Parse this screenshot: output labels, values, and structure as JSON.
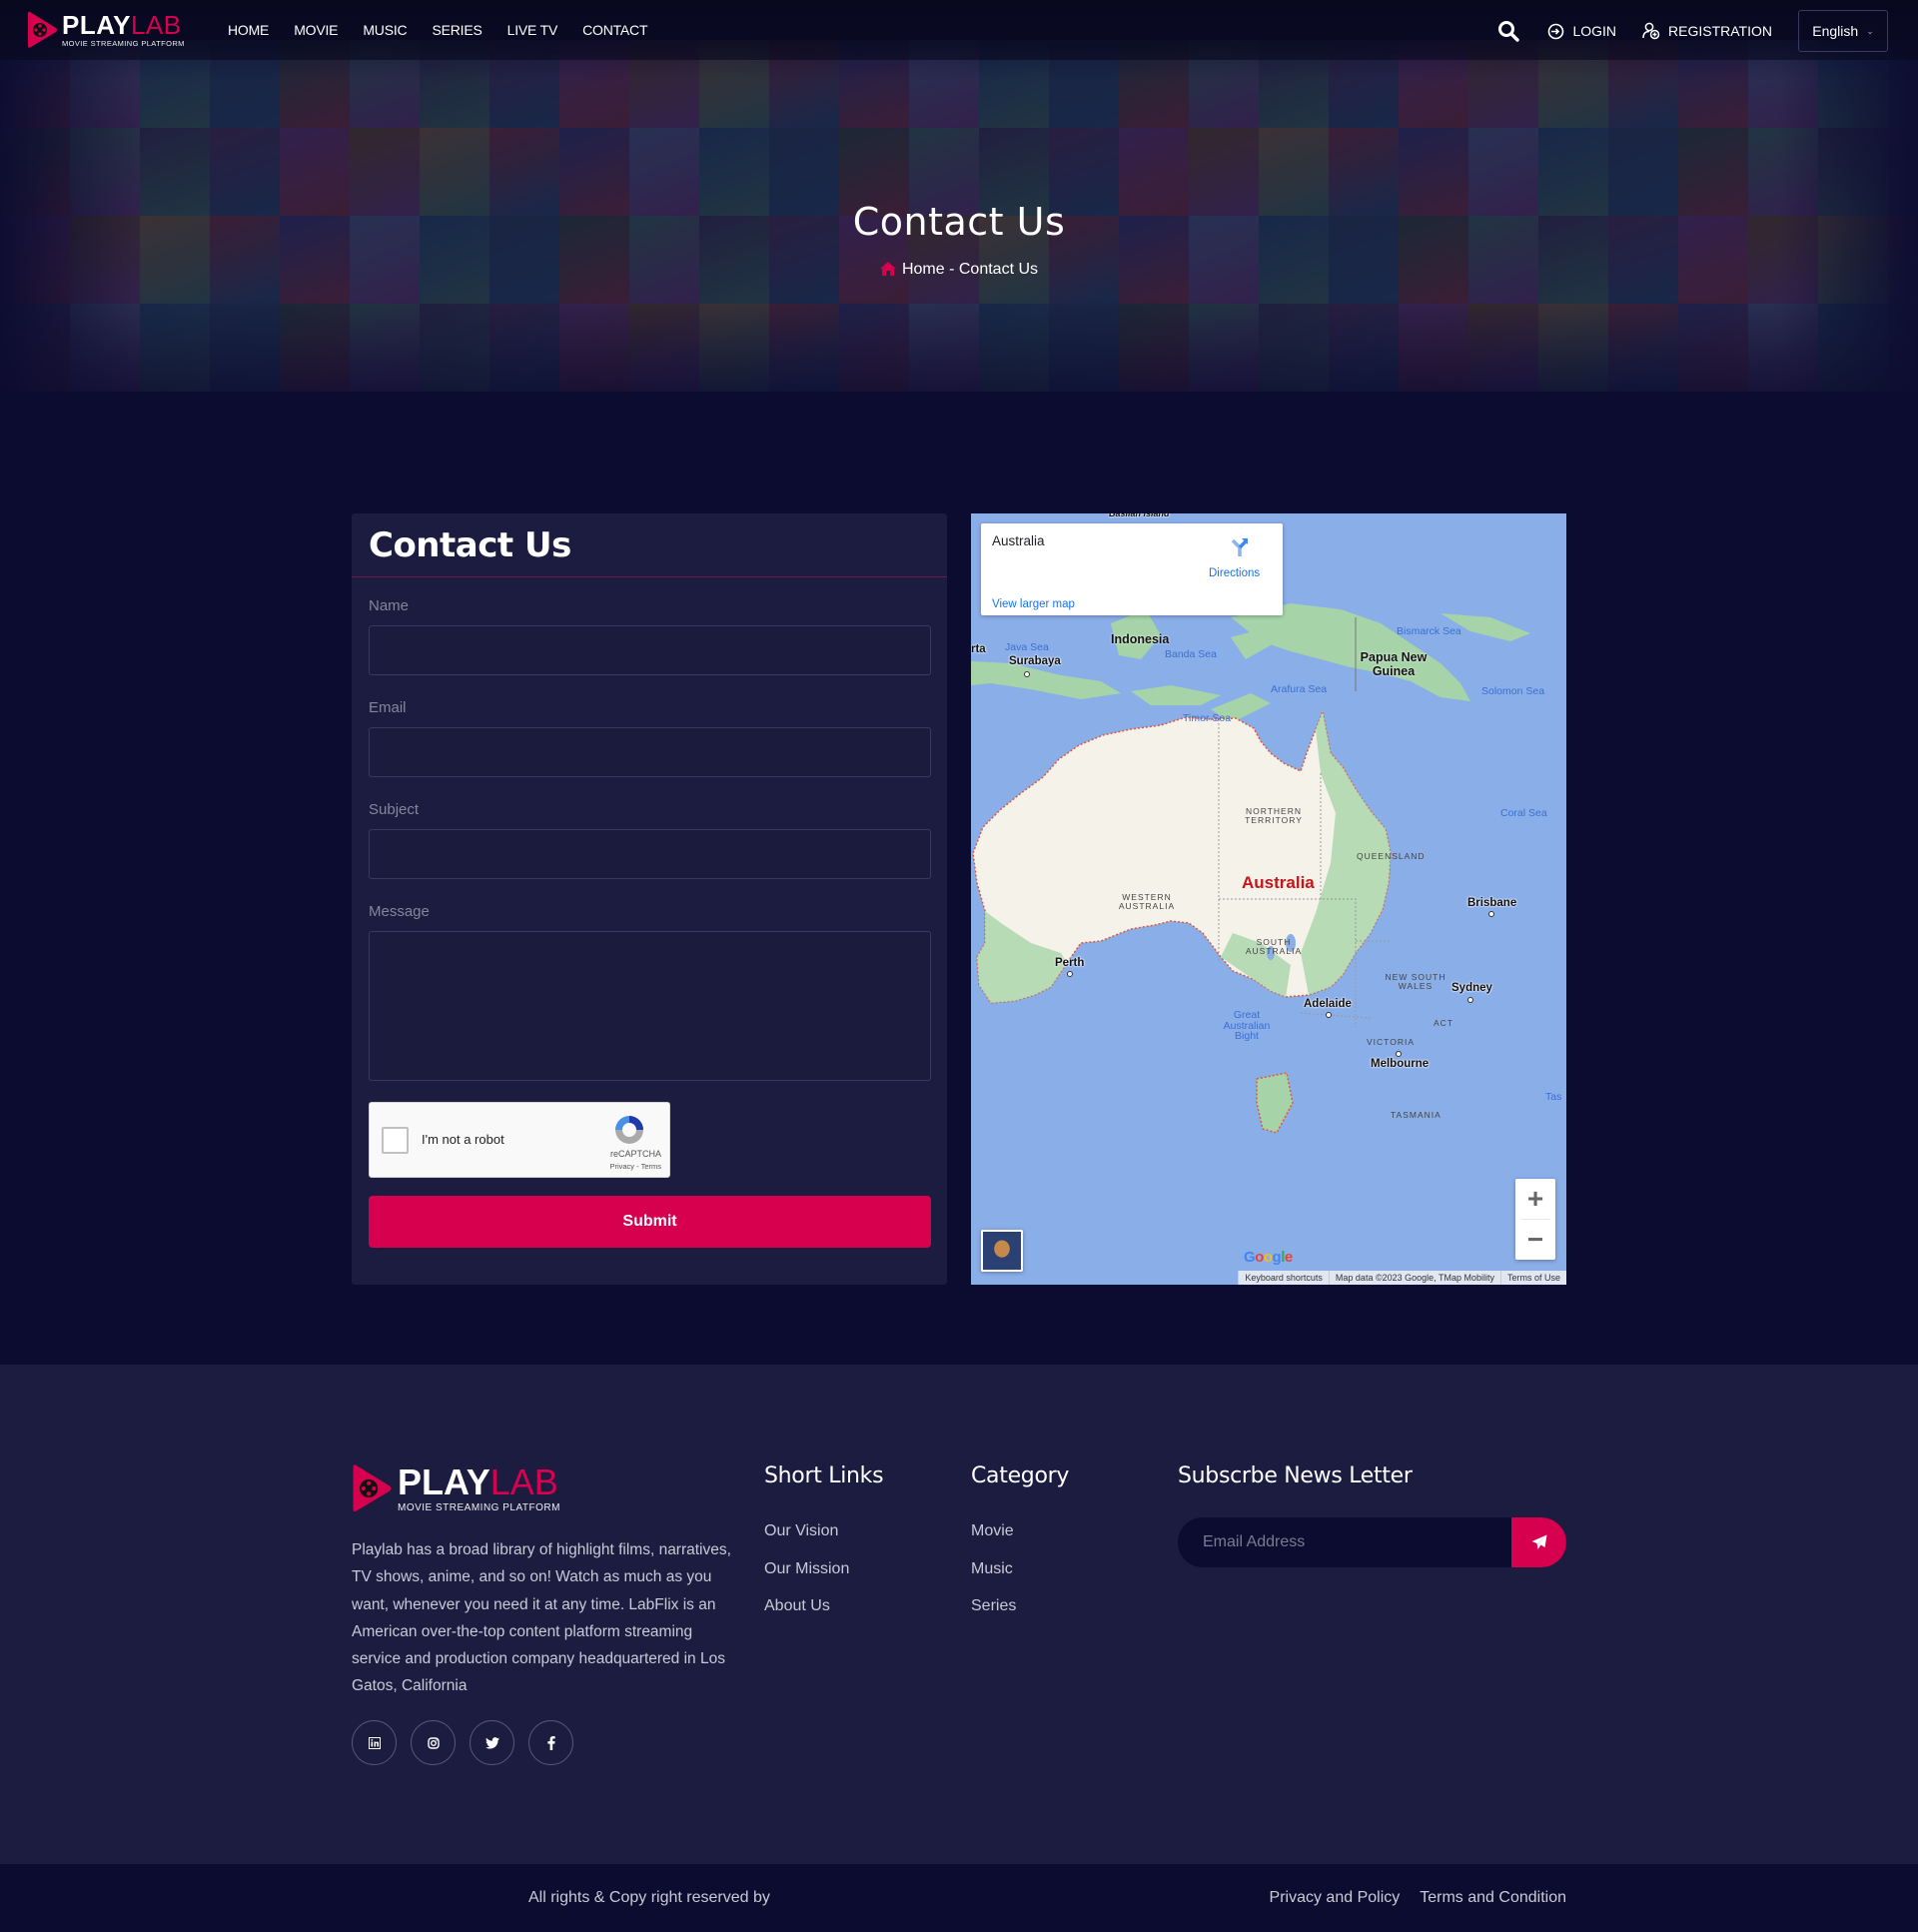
{
  "brand": {
    "name_bold": "PLAY",
    "name_light": "LAB",
    "tagline": "MOVIE STREAMING PLATFORM",
    "accent_color": "#d6004f"
  },
  "nav": {
    "menu": [
      "HOME",
      "MOVIE",
      "MUSIC",
      "SERIES",
      "LIVE TV",
      "CONTACT"
    ],
    "login_label": "LOGIN",
    "registration_label": "REGISTRATION",
    "language": "English"
  },
  "hero": {
    "title": "Contact Us",
    "breadcrumb": "Home - Contact Us"
  },
  "contact_form": {
    "title": "Contact Us",
    "fields": [
      {
        "label": "Name",
        "value": ""
      },
      {
        "label": "Email",
        "value": ""
      },
      {
        "label": "Subject",
        "value": ""
      },
      {
        "label": "Message",
        "value": ""
      }
    ],
    "captcha": {
      "label": "I'm not a robot",
      "brand": "reCAPTCHA",
      "links": "Privacy - Terms",
      "checked": false
    },
    "submit_label": "Submit"
  },
  "map": {
    "place": "Australia",
    "directions_label": "Directions",
    "view_larger_label": "View larger map",
    "labels": {
      "top_cut": "Basilan Island",
      "jakarta_cut": "rta",
      "java_sea": "Java Sea",
      "surabaya": "Surabaya",
      "indonesia": "Indonesia",
      "banda_sea": "Banda Sea",
      "bismarck_sea": "Bismarck Sea",
      "png": "Papua New Guinea",
      "arafura_sea": "Arafura Sea",
      "solomon_sea": "Solomon Sea",
      "timor_sea": "Timor Sea",
      "coral_sea": "Coral Sea",
      "northern_territory": "NORTHERN TERRITORY",
      "queensland": "QUEENSLAND",
      "western_australia": "WESTERN AUSTRALIA",
      "australia": "Australia",
      "south_australia": "SOUTH AUSTRALIA",
      "brisbane": "Brisbane",
      "perth": "Perth",
      "new_south_wales": "NEW SOUTH WALES",
      "sydney": "Sydney",
      "adelaide": "Adelaide",
      "great_australian_bight": "Great Australian Bight",
      "act": "ACT",
      "victoria": "VICTORIA",
      "melbourne": "Melbourne",
      "tasmania": "TASMANIA",
      "tasman_cut": "Tas"
    },
    "attribution": [
      "Keyboard shortcuts",
      "Map data ©2023 Google, TMap Mobility",
      "Terms of Use"
    ],
    "google_logo": "Google"
  },
  "footer": {
    "about": "Playlab has a broad library of highlight films, narratives, TV shows, anime, and so on! Watch as much as you want, whenever you need it at any time. LabFlix is an American over-the-top content platform streaming service and production company headquartered in Los Gatos, California",
    "socials": [
      "linkedin-icon",
      "instagram-icon",
      "twitter-icon",
      "facebook-icon"
    ],
    "short_links": {
      "title": "Short Links",
      "items": [
        "Our Vision",
        "Our Mission",
        "About Us"
      ]
    },
    "category": {
      "title": "Category",
      "items": [
        "Movie",
        "Music",
        "Series"
      ]
    },
    "newsletter": {
      "title": "Subscrbe News Letter",
      "placeholder": "Email Address"
    },
    "copyright": "All rights & Copy right reserved by",
    "bottom_links": [
      "Privacy and Policy",
      "Terms and Condition"
    ]
  }
}
